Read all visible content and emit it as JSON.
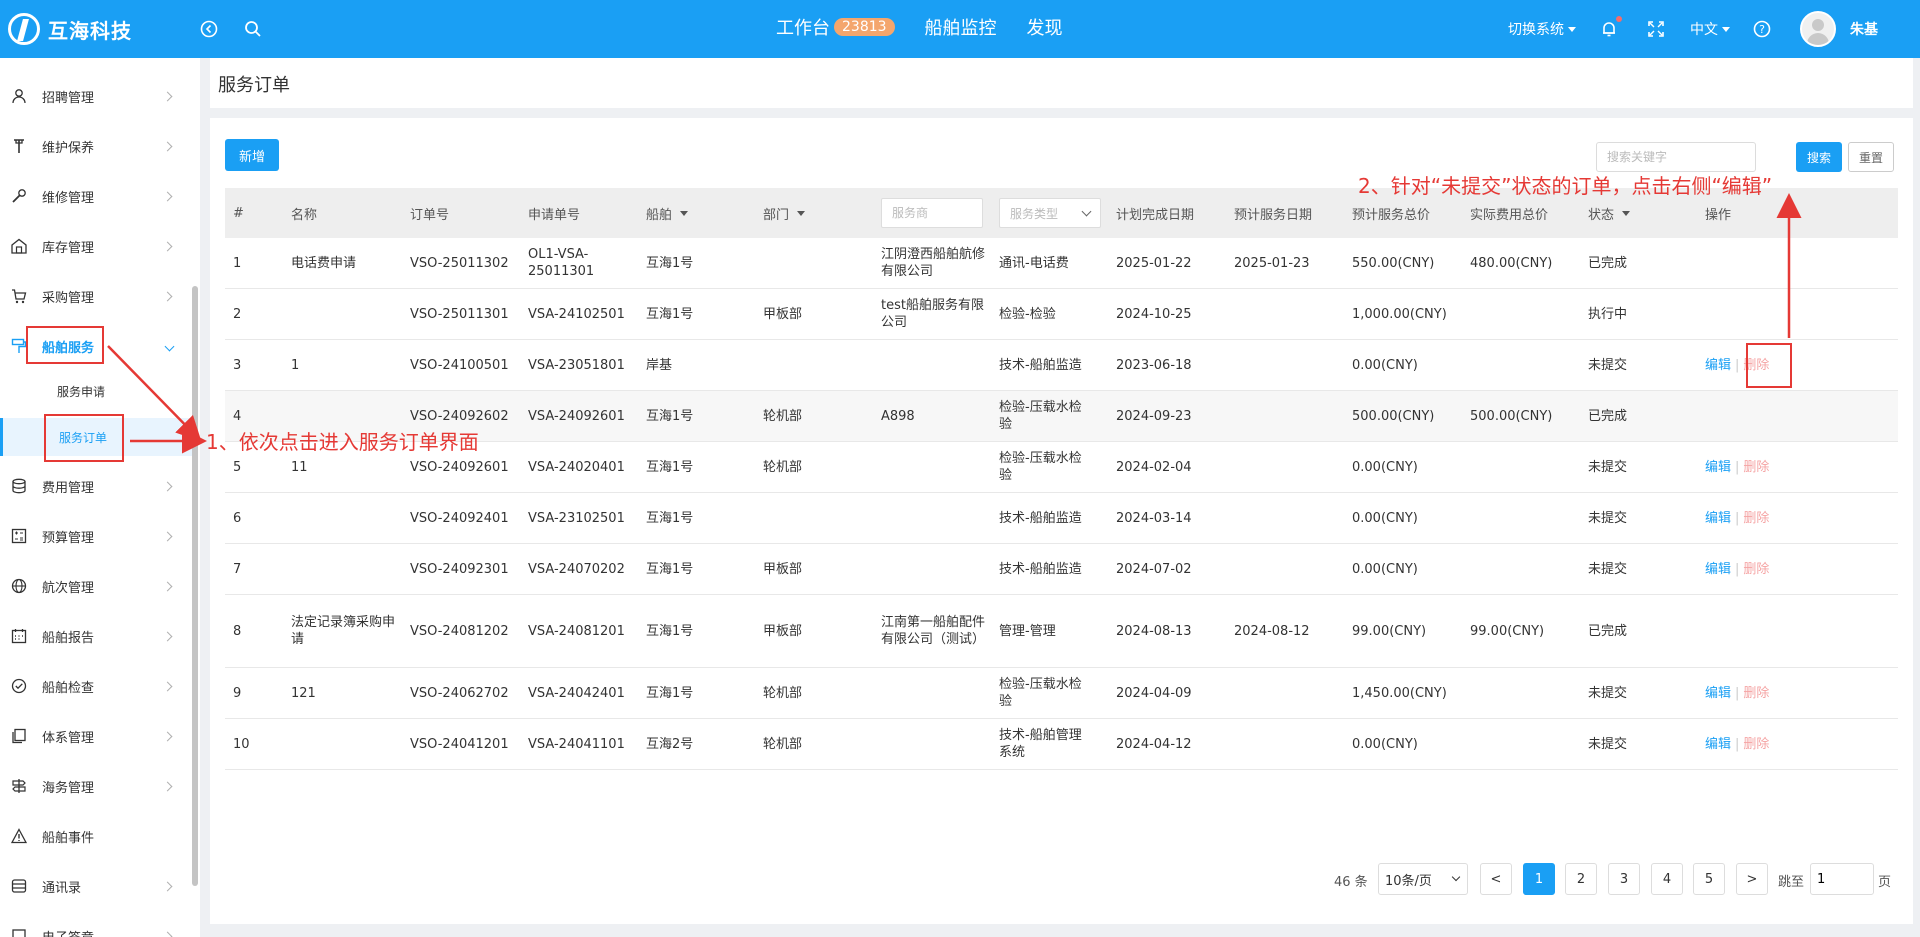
{
  "header": {
    "brand": "互海科技",
    "nav": [
      {
        "label": "工作台",
        "badge": "23813"
      },
      {
        "label": "船舶监控"
      },
      {
        "label": "发现"
      }
    ],
    "switch_system": "切换系统",
    "language": "中文",
    "username": "朱基",
    "colors": {
      "primary": "#1a9ff4",
      "badge": "#f4a66d"
    }
  },
  "sidebar": {
    "items": [
      {
        "label": "招聘管理",
        "icon": "user-icon"
      },
      {
        "label": "维护保养",
        "icon": "wrench-icon"
      },
      {
        "label": "维修管理",
        "icon": "tool-icon"
      },
      {
        "label": "库存管理",
        "icon": "warehouse-icon"
      },
      {
        "label": "采购管理",
        "icon": "cart-icon"
      },
      {
        "label": "船舶服务",
        "icon": "paint-roller-icon"
      },
      {
        "label": "费用管理",
        "icon": "database-icon"
      },
      {
        "label": "预算管理",
        "icon": "calculator-icon"
      },
      {
        "label": "航次管理",
        "icon": "globe-icon"
      },
      {
        "label": "船舶报告",
        "icon": "calendar-icon"
      },
      {
        "label": "船舶检查",
        "icon": "check-circle-icon"
      },
      {
        "label": "体系管理",
        "icon": "document-icon"
      },
      {
        "label": "海务管理",
        "icon": "sign-icon"
      },
      {
        "label": "船舶事件",
        "icon": "warning-icon"
      },
      {
        "label": "通讯录",
        "icon": "contacts-icon"
      },
      {
        "label": "电子签章",
        "icon": "seal-icon"
      }
    ],
    "sub_items": [
      {
        "label": "服务申请"
      },
      {
        "label": "服务订单"
      }
    ]
  },
  "page": {
    "title": "服务订单",
    "add_button": "新增",
    "search_placeholder": "搜索关键字",
    "search_button": "搜索",
    "reset_button": "重置"
  },
  "table": {
    "headers": {
      "idx": "#",
      "name": "名称",
      "order_no": "订单号",
      "apply_no": "申请单号",
      "ship": "船舶",
      "dept": "部门",
      "planned_date": "计划完成日期",
      "expected_date": "预计服务日期",
      "expected_total": "预计服务总价",
      "actual_total": "实际费用总价",
      "status": "状态",
      "ops": "操作"
    },
    "filters": {
      "provider_placeholder": "服务商",
      "type_placeholder": "服务类型"
    },
    "edit_label": "编辑",
    "delete_label": "删除",
    "rows": [
      {
        "idx": "1",
        "name": "电话费申请",
        "order_no": "VSO-25011302",
        "apply_no": "OL1-VSA-25011301",
        "ship": "互海1号",
        "dept": "",
        "provider": "江阴澄西船舶航修有限公司",
        "type": "通讯-电话费",
        "planned": "2025-01-22",
        "expected": "2025-01-23",
        "exp_total": "550.00(CNY)",
        "act_total": "480.00(CNY)",
        "status": "已完成",
        "ops": false
      },
      {
        "idx": "2",
        "name": "",
        "order_no": "VSO-25011301",
        "apply_no": "VSA-24102501",
        "ship": "互海1号",
        "dept": "甲板部",
        "provider": "test船舶服务有限公司",
        "type": "检验-检验",
        "planned": "2024-10-25",
        "expected": "",
        "exp_total": "1,000.00(CNY)",
        "act_total": "",
        "status": "执行中",
        "ops": false
      },
      {
        "idx": "3",
        "name": "1",
        "order_no": "VSO-24100501",
        "apply_no": "VSA-23051801",
        "ship": "岸基",
        "dept": "",
        "provider": "",
        "type": "技术-船舶监造",
        "planned": "2023-06-18",
        "expected": "",
        "exp_total": "0.00(CNY)",
        "act_total": "",
        "status": "未提交",
        "ops": true
      },
      {
        "idx": "4",
        "name": "",
        "order_no": "VSO-24092602",
        "apply_no": "VSA-24092601",
        "ship": "互海1号",
        "dept": "轮机部",
        "provider": "A898",
        "type": "检验-压载水检验",
        "planned": "2024-09-23",
        "expected": "",
        "exp_total": "500.00(CNY)",
        "act_total": "500.00(CNY)",
        "status": "已完成",
        "ops": false
      },
      {
        "idx": "5",
        "name": "11",
        "order_no": "VSO-24092601",
        "apply_no": "VSA-24020401",
        "ship": "互海1号",
        "dept": "轮机部",
        "provider": "",
        "type": "检验-压载水检验",
        "planned": "2024-02-04",
        "expected": "",
        "exp_total": "0.00(CNY)",
        "act_total": "",
        "status": "未提交",
        "ops": true
      },
      {
        "idx": "6",
        "name": "",
        "order_no": "VSO-24092401",
        "apply_no": "VSA-23102501",
        "ship": "互海1号",
        "dept": "",
        "provider": "",
        "type": "技术-船舶监造",
        "planned": "2024-03-14",
        "expected": "",
        "exp_total": "0.00(CNY)",
        "act_total": "",
        "status": "未提交",
        "ops": true
      },
      {
        "idx": "7",
        "name": "",
        "order_no": "VSO-24092301",
        "apply_no": "VSA-24070202",
        "ship": "互海1号",
        "dept": "甲板部",
        "provider": "",
        "type": "技术-船舶监造",
        "planned": "2024-07-02",
        "expected": "",
        "exp_total": "0.00(CNY)",
        "act_total": "",
        "status": "未提交",
        "ops": true
      },
      {
        "idx": "8",
        "name": "法定记录簿采购申请",
        "order_no": "VSO-24081202",
        "apply_no": "VSA-24081201",
        "ship": "互海1号",
        "dept": "甲板部",
        "provider": "江南第一船舶配件有限公司（测试）",
        "type": "管理-管理",
        "planned": "2024-08-13",
        "expected": "2024-08-12",
        "exp_total": "99.00(CNY)",
        "act_total": "99.00(CNY)",
        "status": "已完成",
        "ops": false
      },
      {
        "idx": "9",
        "name": "121",
        "order_no": "VSO-24062702",
        "apply_no": "VSA-24042401",
        "ship": "互海1号",
        "dept": "轮机部",
        "provider": "",
        "type": "检验-压载水检验",
        "planned": "2024-04-09",
        "expected": "",
        "exp_total": "1,450.00(CNY)",
        "act_total": "",
        "status": "未提交",
        "ops": true
      },
      {
        "idx": "10",
        "name": "",
        "order_no": "VSO-24041201",
        "apply_no": "VSA-24041101",
        "ship": "互海2号",
        "dept": "轮机部",
        "provider": "",
        "type": "技术-船舶管理系统",
        "planned": "2024-04-12",
        "expected": "",
        "exp_total": "0.00(CNY)",
        "act_total": "",
        "status": "未提交",
        "ops": true
      }
    ]
  },
  "pagination": {
    "total": "46 条",
    "page_size": "10条/页",
    "prev": "<",
    "next": ">",
    "pages": [
      "1",
      "2",
      "3",
      "4",
      "5"
    ],
    "current": "1",
    "jump_label": "跳至",
    "jump_value": "1",
    "page_unit": "页"
  },
  "annotations": {
    "step1": "1、依次点击进入服务订单界面",
    "step2": "2、针对“未提交”状态的订单，点击右侧“编辑”",
    "color": "#e53935"
  }
}
